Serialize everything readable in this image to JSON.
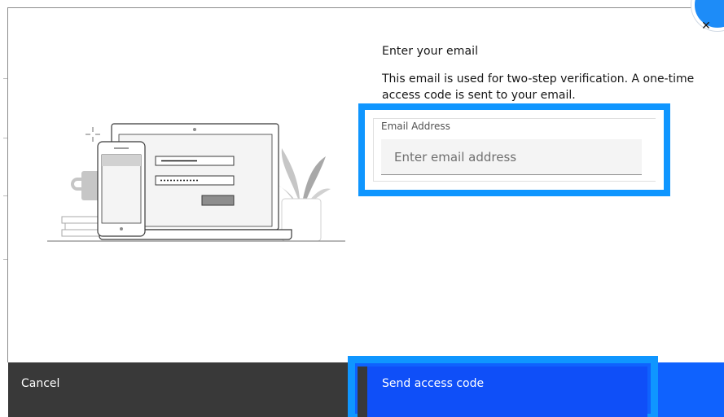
{
  "dialog": {
    "title": "Enter your email",
    "description": "This email is used for two-step verification. A one-time access code is sent to your email.",
    "close_icon": "close-icon",
    "step_badge_color": "#1d8cf8"
  },
  "email_field": {
    "label": "Email Address",
    "placeholder": "Enter email address",
    "value": ""
  },
  "footer": {
    "cancel_label": "Cancel",
    "send_label": "Send access code"
  },
  "colors": {
    "primary": "#0f62fe",
    "highlight": "#0f96ff",
    "secondary": "#393939",
    "field_bg": "#f4f4f4",
    "text": "#161616"
  },
  "illustration": {
    "name": "laptop-phone-login-illustration"
  }
}
